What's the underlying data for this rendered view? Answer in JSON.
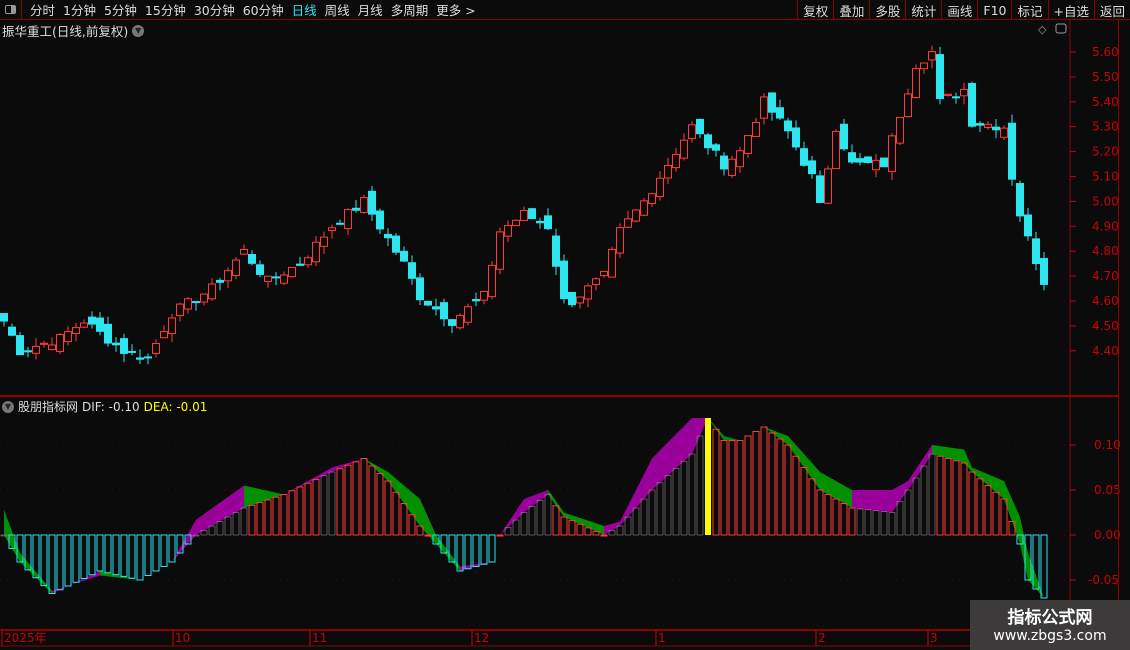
{
  "toolbar": {
    "periods": [
      "分时",
      "1分钟",
      "5分钟",
      "15分钟",
      "30分钟",
      "60分钟",
      "日线",
      "周线",
      "月线",
      "多周期",
      "更多 >"
    ],
    "active_period": "日线",
    "buttons": [
      "复权",
      "叠加",
      "多股",
      "统计",
      "画线",
      "F10",
      "标记",
      "+自选",
      "返回"
    ]
  },
  "chart_title": "振华重工(日线,前复权)",
  "indicator": {
    "name": "股朋指标网",
    "dif": "DIF: -0.10",
    "dea": "DEA: -0.01"
  },
  "colors": {
    "up": "#ff3b3b",
    "down": "#2ee6f0",
    "axis": "#cc0000",
    "band_rise": "#9a009a",
    "band_fall": "#009000",
    "highlight": "#ffff00",
    "neutral": "#8a8a8a"
  },
  "price_axis": [
    "5.60",
    "5.50",
    "5.40",
    "5.30",
    "5.20",
    "5.10",
    "5.00",
    "4.90",
    "4.80",
    "4.70",
    "4.60",
    "4.50",
    "4.40"
  ],
  "indicator_axis": [
    "0.10",
    "0.05",
    "0.00",
    "-0.05"
  ],
  "date_axis": [
    "2025年",
    "10",
    "11",
    "12",
    "1",
    "2",
    "3"
  ],
  "watermark": {
    "line1": "指标公式网",
    "line2": "www.zbgs3.com"
  },
  "chart_data": [
    {
      "type": "candlestick",
      "candles": 131,
      "ylim": [
        4.35,
        5.65
      ],
      "close_samples": [
        [
          0,
          4.52
        ],
        [
          2,
          4.4
        ],
        [
          7,
          4.45
        ],
        [
          10,
          4.52
        ],
        [
          15,
          4.4
        ],
        [
          18,
          4.37
        ],
        [
          21,
          4.55
        ],
        [
          26,
          4.65
        ],
        [
          30,
          4.8
        ],
        [
          33,
          4.68
        ],
        [
          37,
          4.75
        ],
        [
          41,
          4.9
        ],
        [
          45,
          5.0
        ],
        [
          47,
          4.9
        ],
        [
          50,
          4.75
        ],
        [
          52,
          4.62
        ],
        [
          56,
          4.52
        ],
        [
          60,
          4.62
        ],
        [
          62,
          4.88
        ],
        [
          65,
          4.95
        ],
        [
          68,
          4.9
        ],
        [
          70,
          4.6
        ],
        [
          71,
          4.6
        ],
        [
          75,
          4.7
        ],
        [
          77,
          4.88
        ],
        [
          80,
          5.0
        ],
        [
          82,
          5.1
        ],
        [
          86,
          5.3
        ],
        [
          90,
          5.15
        ],
        [
          92,
          5.2
        ],
        [
          95,
          5.4
        ],
        [
          98,
          5.28
        ],
        [
          101,
          5.1
        ],
        [
          102,
          4.98
        ],
        [
          104,
          5.3
        ],
        [
          106,
          5.15
        ],
        [
          110,
          5.15
        ],
        [
          112,
          5.35
        ],
        [
          114,
          5.55
        ],
        [
          116,
          5.6
        ],
        [
          117,
          5.4
        ],
        [
          120,
          5.45
        ],
        [
          121,
          5.32
        ],
        [
          125,
          5.3
        ],
        [
          126,
          5.1
        ],
        [
          127,
          4.95
        ],
        [
          128,
          4.85
        ],
        [
          130,
          4.68
        ]
      ]
    },
    {
      "type": "bar",
      "ylim": [
        -0.075,
        0.145
      ],
      "series": [
        {
          "values": [
            [
              0,
              0.028
            ],
            [
              2,
              -0.02
            ],
            [
              6,
              -0.062
            ],
            [
              12,
              -0.045
            ],
            [
              17,
              -0.05
            ],
            [
              21,
              -0.03
            ],
            [
              24,
              0.017
            ],
            [
              30,
              0.055
            ],
            [
              35,
              0.045
            ],
            [
              41,
              0.075
            ],
            [
              45,
              0.085
            ],
            [
              48,
              0.07
            ],
            [
              52,
              0.04
            ],
            [
              54,
              0.0
            ],
            [
              57,
              -0.035
            ],
            [
              61,
              -0.03
            ],
            [
              62,
              0.0
            ],
            [
              65,
              0.04
            ],
            [
              68,
              0.05
            ],
            [
              70,
              0.025
            ],
            [
              75,
              0.01
            ],
            [
              77,
              0.015
            ],
            [
              81,
              0.085
            ],
            [
              86,
              0.13
            ],
            [
              88,
              0.13
            ],
            [
              90,
              0.11
            ],
            [
              92,
              0.105
            ],
            [
              95,
              0.12
            ],
            [
              98,
              0.11
            ],
            [
              102,
              0.07
            ],
            [
              106,
              0.05
            ],
            [
              111,
              0.05
            ],
            [
              113,
              0.06
            ],
            [
              116,
              0.1
            ],
            [
              120,
              0.095
            ],
            [
              121,
              0.075
            ],
            [
              125,
              0.06
            ],
            [
              127,
              0.02
            ],
            [
              128,
              -0.02
            ],
            [
              130,
              -0.07
            ]
          ]
        },
        {
          "values": [
            [
              0,
              0.0
            ],
            [
              2,
              -0.03
            ],
            [
              6,
              -0.065
            ],
            [
              12,
              -0.04
            ],
            [
              17,
              -0.05
            ],
            [
              21,
              -0.03
            ],
            [
              24,
              0.0
            ],
            [
              30,
              0.03
            ],
            [
              35,
              0.045
            ],
            [
              41,
              0.07
            ],
            [
              45,
              0.085
            ],
            [
              48,
              0.06
            ],
            [
              52,
              0.01
            ],
            [
              54,
              -0.01
            ],
            [
              57,
              -0.04
            ],
            [
              61,
              -0.03
            ],
            [
              62,
              0.0
            ],
            [
              65,
              0.025
            ],
            [
              68,
              0.045
            ],
            [
              70,
              0.02
            ],
            [
              75,
              0.0
            ],
            [
              77,
              0.01
            ],
            [
              81,
              0.05
            ],
            [
              86,
              0.09
            ],
            [
              88,
              0.13
            ],
            [
              90,
              0.105
            ],
            [
              92,
              0.105
            ],
            [
              95,
              0.12
            ],
            [
              98,
              0.1
            ],
            [
              102,
              0.05
            ],
            [
              106,
              0.03
            ],
            [
              111,
              0.025
            ],
            [
              113,
              0.05
            ],
            [
              116,
              0.09
            ],
            [
              120,
              0.08
            ],
            [
              121,
              0.07
            ],
            [
              125,
              0.04
            ],
            [
              127,
              -0.01
            ],
            [
              128,
              -0.05
            ],
            [
              130,
              -0.07
            ]
          ]
        }
      ]
    }
  ]
}
